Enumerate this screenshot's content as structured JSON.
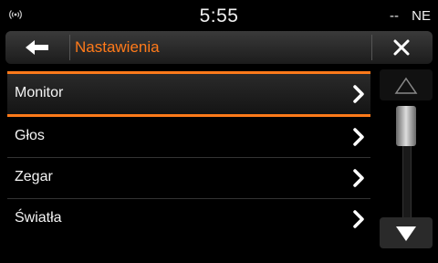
{
  "status": {
    "time": "5:55",
    "left_indicator": "--",
    "right_indicator": "NE"
  },
  "header": {
    "title": "Nastawienia"
  },
  "menu": {
    "items": [
      {
        "label": "Monitor",
        "selected": true
      },
      {
        "label": "Głos"
      },
      {
        "label": "Zegar"
      },
      {
        "label": "Światła"
      }
    ]
  },
  "colors": {
    "accent": "#ff7a1a"
  },
  "icons": {
    "back": "back-arrow-icon",
    "close": "close-icon",
    "chevron": "chevron-right-icon",
    "scroll_up": "triangle-up-icon",
    "scroll_down": "triangle-down-icon",
    "signal": "signal-icon"
  }
}
